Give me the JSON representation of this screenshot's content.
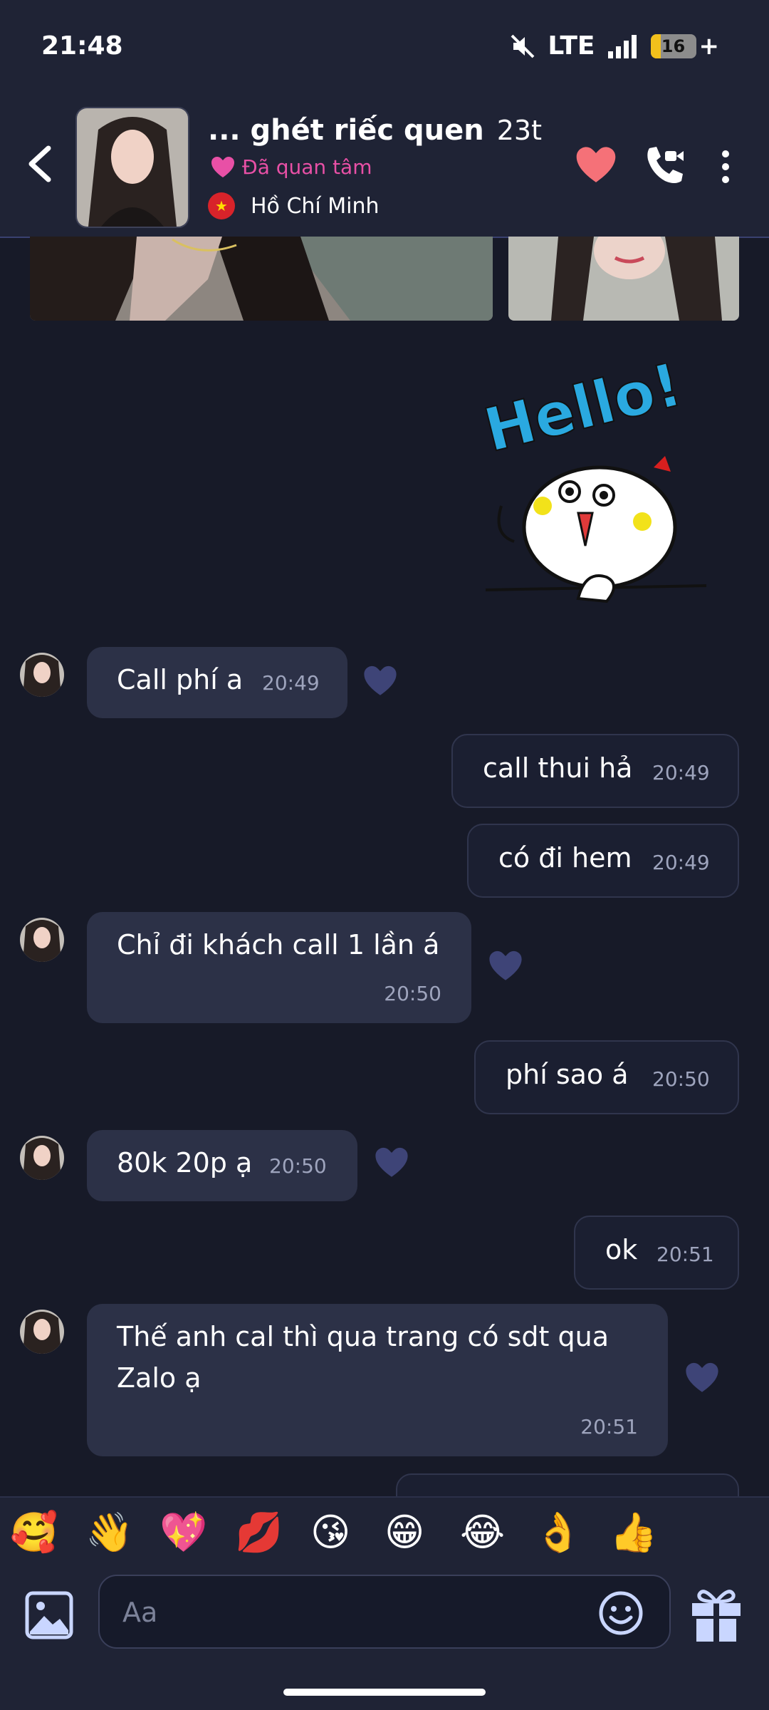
{
  "status_bar": {
    "time": "21:48",
    "network": "LTE",
    "battery": "16",
    "battery_level": 0.16,
    "icons": [
      "mute-icon",
      "signal-icon",
      "battery-icon"
    ]
  },
  "header": {
    "name": "... ghét riếc quen",
    "age": "23t",
    "follow_status": "Đã quan tâm",
    "location": "Hồ Chí Minh",
    "icons": [
      "back-icon",
      "heart-icon",
      "video-call-icon",
      "more-icon"
    ]
  },
  "messages": [
    {
      "side": "in",
      "text": "Call phí a",
      "time": "20:49"
    },
    {
      "side": "out",
      "text": "call thui hả",
      "time": "20:49"
    },
    {
      "side": "out",
      "text": "có đi hem",
      "time": "20:49"
    },
    {
      "side": "in",
      "text": "Chỉ đi khách call 1 lần á",
      "time": "20:50"
    },
    {
      "side": "out",
      "text": "phí sao á",
      "time": "20:50"
    },
    {
      "side": "in",
      "text": "80k 20p ạ",
      "time": "20:50"
    },
    {
      "side": "out",
      "text": "ok",
      "time": "20:51"
    },
    {
      "side": "in",
      "text_lines": [
        "Thế anh cal thì qua trang có sdt qua",
        "Zalo ạ"
      ],
      "time": "20:51"
    }
  ],
  "sticker_text": "Hello!",
  "quick_emojis": [
    "🥰",
    "👋",
    "💖",
    "💋",
    "😘",
    "😁",
    "😂",
    "👌",
    "👍"
  ],
  "composer": {
    "placeholder": "Aa",
    "icons": [
      "image-icon",
      "smiley-icon",
      "gift-icon"
    ]
  },
  "colors": {
    "background": "#171a28",
    "header": "#1f2335",
    "incoming_bubble": "#2c3147",
    "accent_pink": "#e850a6",
    "reaction_heart": "#3e4477"
  }
}
